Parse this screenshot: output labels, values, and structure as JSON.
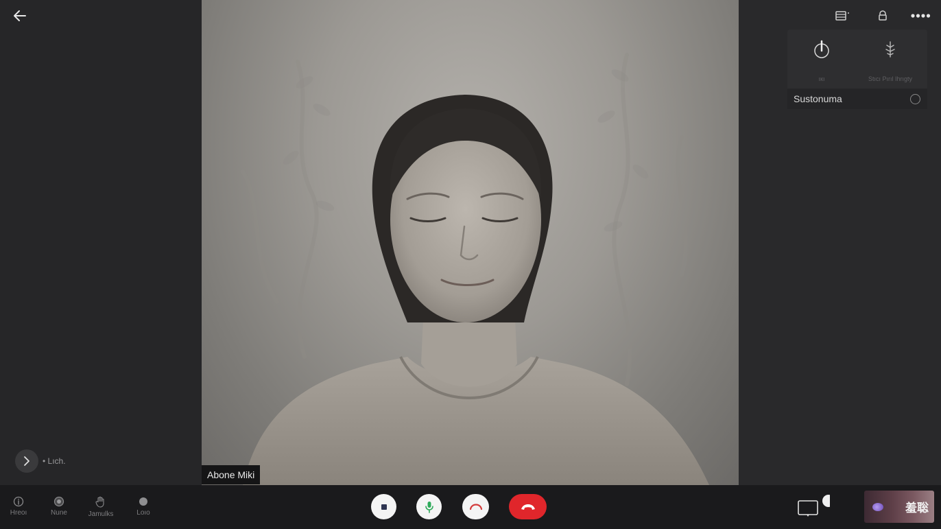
{
  "header": {
    "back_icon": "arrow-left-icon",
    "icons": [
      "layout-icon",
      "lock-icon",
      "more-icon"
    ]
  },
  "popover": {
    "options": [
      {
        "icon": "touch-icon",
        "label": "ıкı"
      },
      {
        "icon": "tree-icon",
        "label": "Stıcı Pırıl Ihrıgty"
      }
    ],
    "row_label": "Sustonuma",
    "row_selected": false
  },
  "participant": {
    "name": "Abone Miki"
  },
  "left_panel": {
    "expand_label": "• Lıch."
  },
  "toolbar": {
    "left_tools": [
      {
        "icon": "info-icon",
        "label": "Hreoı"
      },
      {
        "icon": "camera-lens-icon",
        "label": "Nune"
      },
      {
        "icon": "hand-icon",
        "label": "Jamulks"
      },
      {
        "icon": "circle-icon",
        "label": "Loıo"
      }
    ],
    "controls": [
      {
        "icon": "stop-icon",
        "name": "stop-video"
      },
      {
        "icon": "mic-icon",
        "name": "microphone"
      },
      {
        "icon": "hang-up-icon",
        "name": "hold"
      },
      {
        "icon": "end-call-icon",
        "name": "end-call"
      }
    ],
    "thumb_label": "羞聡"
  },
  "colors": {
    "end_call": "#e0262b",
    "mic": "#2eaa5a",
    "hang_up": "#d33a3a",
    "stop": "#2f3552"
  }
}
